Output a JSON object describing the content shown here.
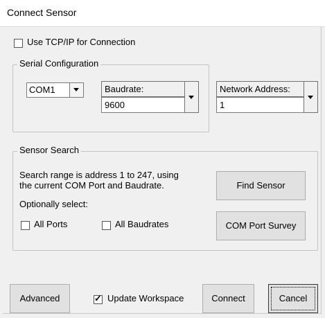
{
  "window": {
    "title": "Connect Sensor"
  },
  "tcp": {
    "label": "Use TCP/IP for Connection",
    "checked": false
  },
  "serial": {
    "group_title": "Serial Configuration",
    "port": "COM1",
    "baudrate_header": "Baudrate:",
    "baudrate_value": "9600"
  },
  "network": {
    "header": "Network Address:",
    "value": "1"
  },
  "search": {
    "group_title": "Sensor Search",
    "description_line1": "Search range is address 1 to 247, using",
    "description_line2": "the current COM Port and Baudrate.",
    "optional_label": "Optionally select:",
    "all_ports_label": "All Ports",
    "all_ports_checked": false,
    "all_baudrates_label": "All Baudrates",
    "all_baudrates_checked": false,
    "find_button": "Find Sensor",
    "survey_button": "COM Port Survey"
  },
  "footer": {
    "advanced_button": "Advanced",
    "update_label": "Update Workspace",
    "update_checked": true,
    "check_mark": "✓",
    "connect_button": "Connect",
    "cancel_button": "Cancel"
  }
}
